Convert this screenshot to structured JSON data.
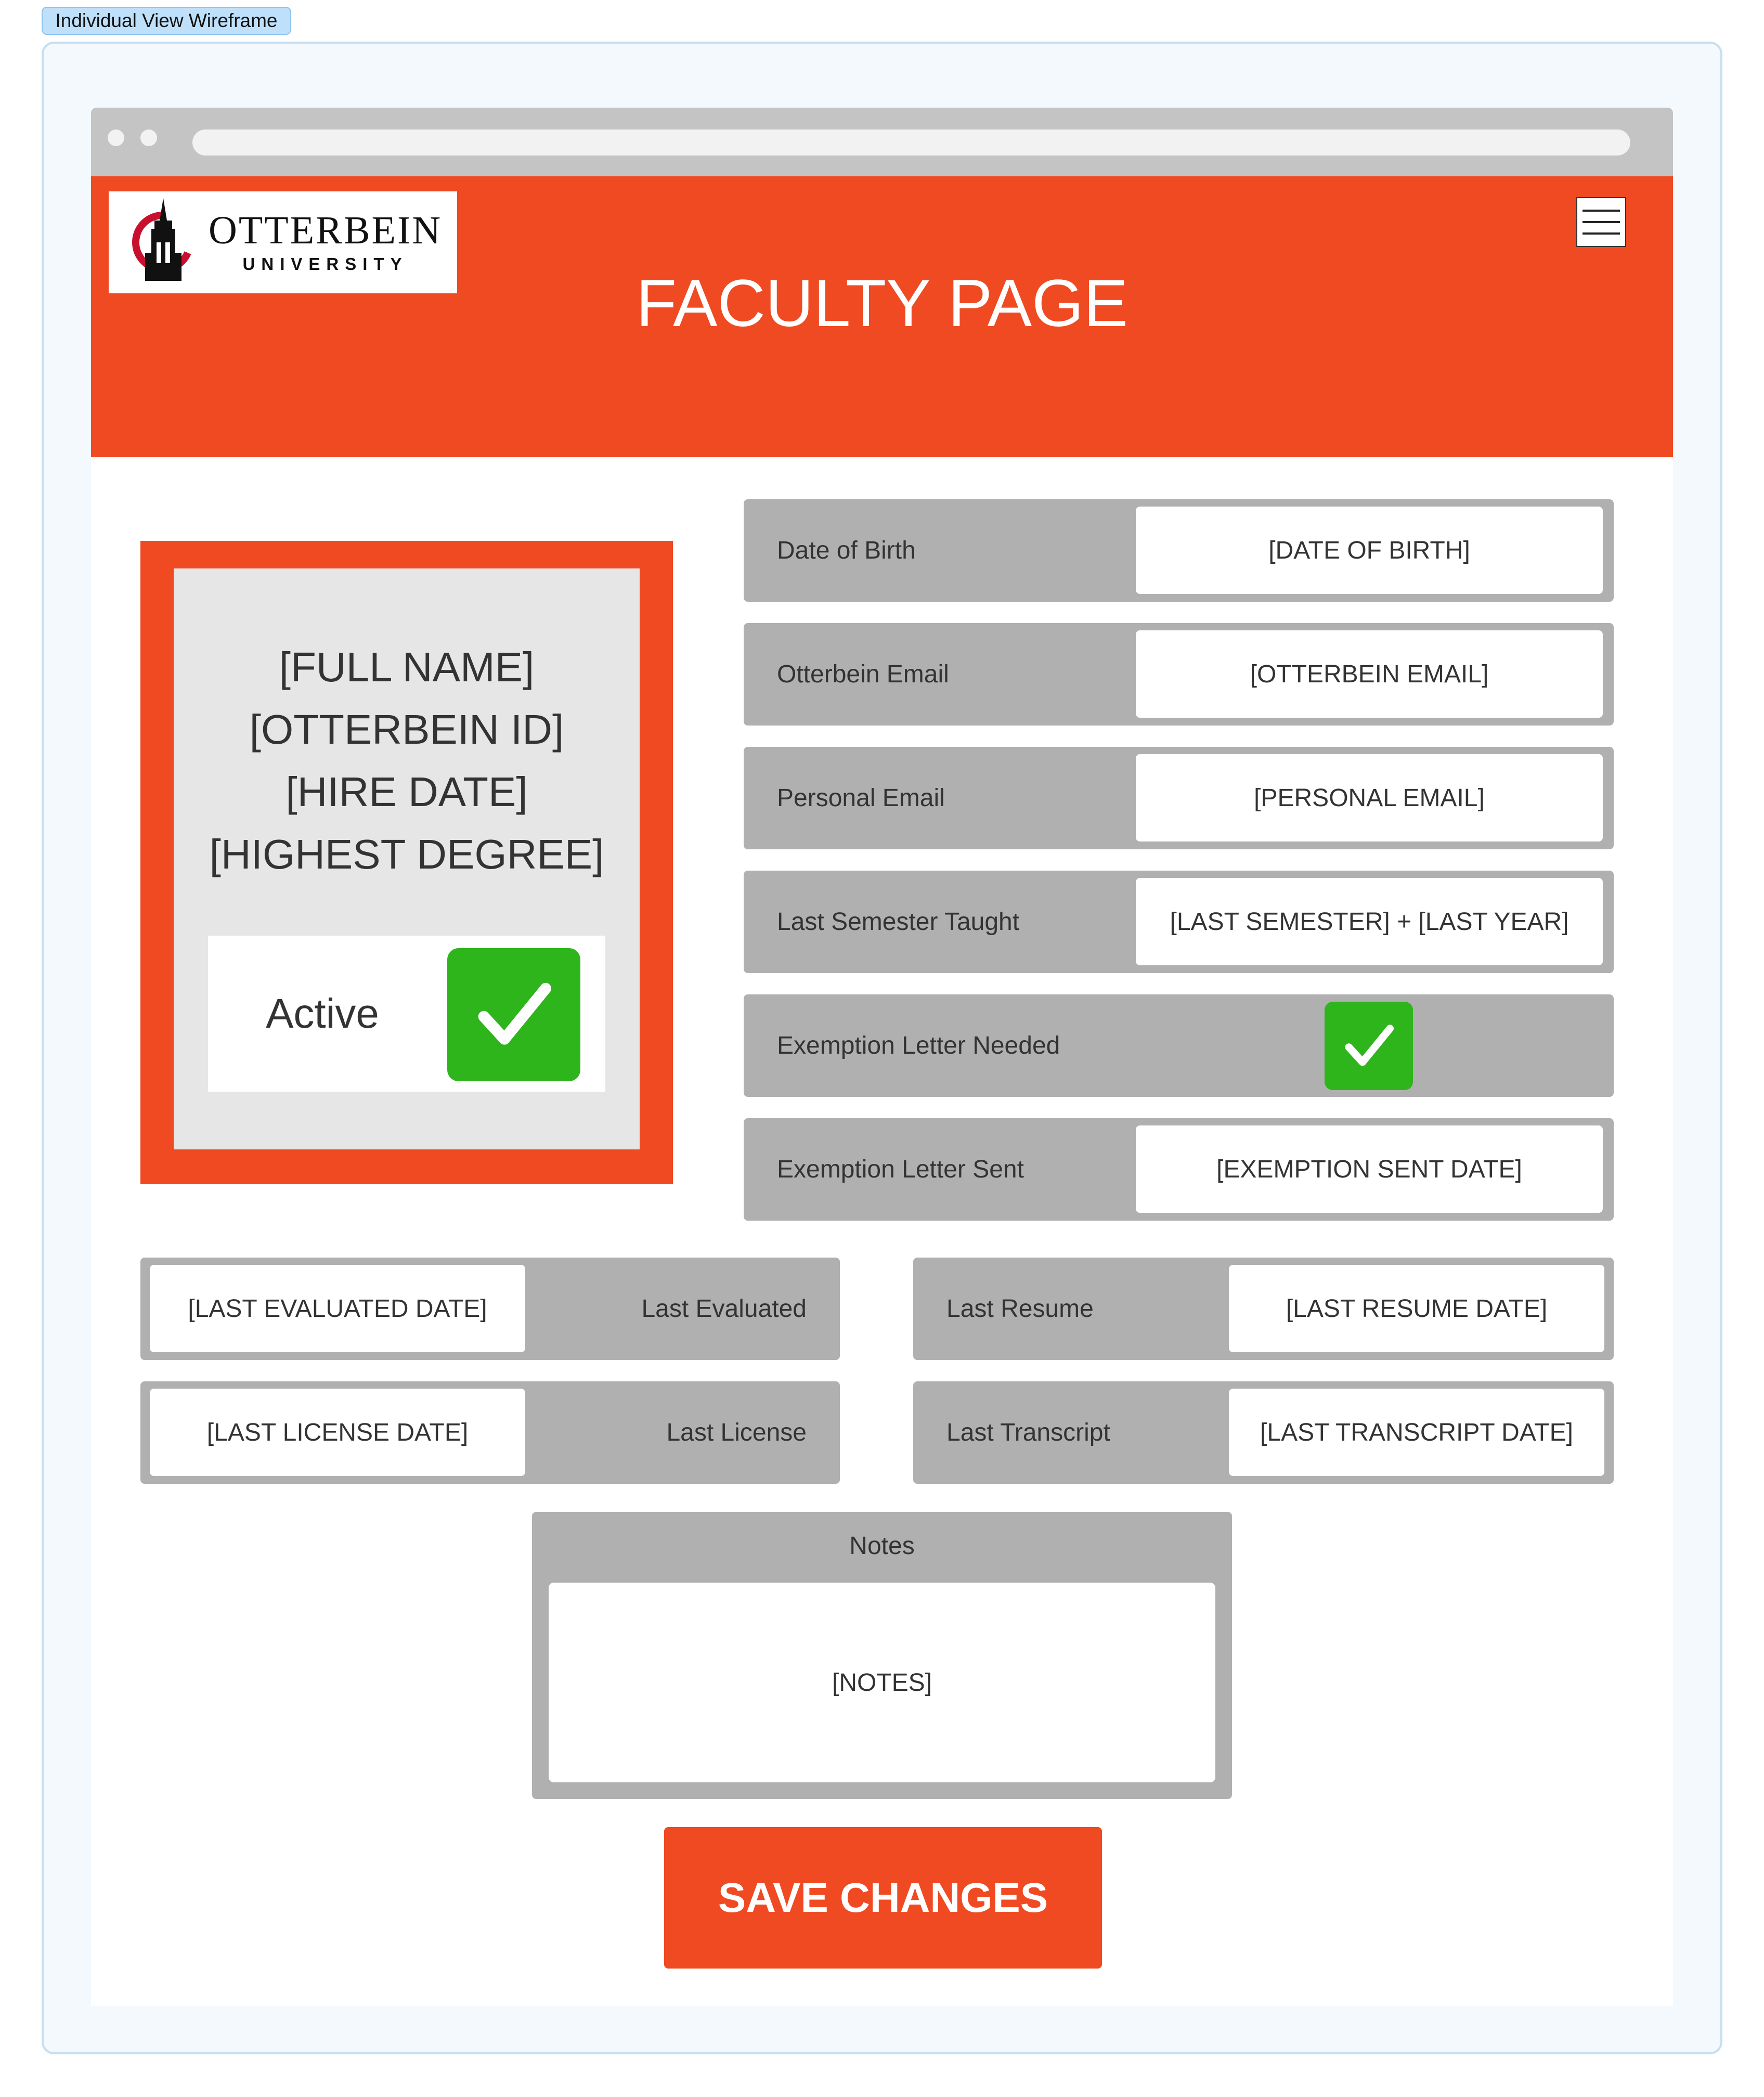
{
  "frame_tag": "Individual View Wireframe",
  "header": {
    "title": "FACULTY PAGE",
    "logo_name": "OTTERBEIN",
    "logo_sub": "UNIVERSITY"
  },
  "profile": {
    "full_name": "[FULL NAME]",
    "otterbein_id": "[OTTERBEIN ID]",
    "hire_date": "[HIRE DATE]",
    "highest_degree": "[HIGHEST DEGREE]",
    "active_label": "Active",
    "active_checked": true
  },
  "details": [
    {
      "label": "Date of Birth",
      "value": "[DATE OF BIRTH]"
    },
    {
      "label": "Otterbein Email",
      "value": "[OTTERBEIN EMAIL]"
    },
    {
      "label": "Personal Email",
      "value": "[PERSONAL EMAIL]"
    },
    {
      "label": "Last Semester Taught",
      "value": "[LAST SEMESTER] + [LAST YEAR]"
    },
    {
      "label": "Exemption Letter Needed",
      "checked": true
    },
    {
      "label": "Exemption Letter Sent",
      "value": "[EXEMPTION SENT DATE]"
    }
  ],
  "dates": {
    "last_evaluated": {
      "label": "Last Evaluated",
      "value": "[LAST EVALUATED DATE]"
    },
    "last_license": {
      "label": "Last License",
      "value": "[LAST LICENSE DATE]"
    },
    "last_resume": {
      "label": "Last Resume",
      "value": "[LAST RESUME DATE]"
    },
    "last_transcript": {
      "label": "Last Transcript",
      "value": "[LAST TRANSCRIPT DATE]"
    }
  },
  "notes": {
    "label": "Notes",
    "value": "[NOTES]"
  },
  "save_label": "SAVE CHANGES",
  "colors": {
    "brand_orange": "#f04a23",
    "field_gray": "#b0b0b0",
    "check_green": "#2db51b"
  }
}
